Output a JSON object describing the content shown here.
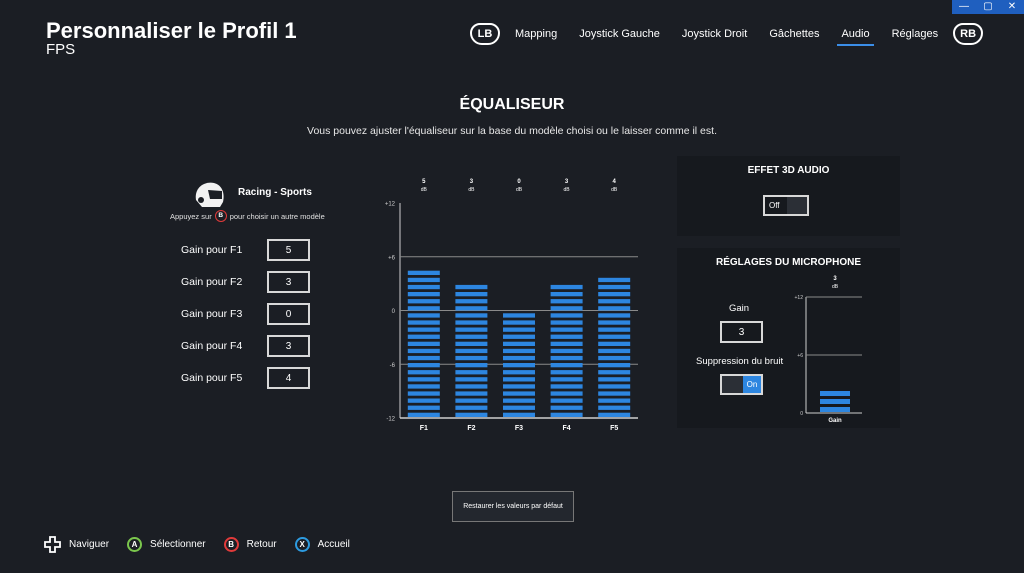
{
  "window": {
    "minimize": "—",
    "maximize": "▢",
    "close": "✕"
  },
  "header": {
    "title": "Personnaliser le Profil 1",
    "subtitle": "FPS",
    "lb": "LB",
    "rb": "RB",
    "tabs": [
      {
        "label": "Mapping",
        "active": false
      },
      {
        "label": "Joystick Gauche",
        "active": false
      },
      {
        "label": "Joystick Droit",
        "active": false
      },
      {
        "label": "Gâchettes",
        "active": false
      },
      {
        "label": "Audio",
        "active": true
      },
      {
        "label": "Réglages",
        "active": false
      }
    ]
  },
  "equalizer": {
    "title": "ÉQUALISEUR",
    "description": "Vous pouvez ajuster l'équaliseur sur la base du modèle choisi ou le laisser comme il est.",
    "preset_name": "Racing - Sports",
    "hint_prefix": "Appuyez sur",
    "hint_button": "B",
    "hint_suffix": "pour choisir un autre modèle",
    "gains": [
      {
        "label": "Gain pour F1",
        "value": "5"
      },
      {
        "label": "Gain pour F2",
        "value": "3"
      },
      {
        "label": "Gain pour F3",
        "value": "0"
      },
      {
        "label": "Gain pour F4",
        "value": "3"
      },
      {
        "label": "Gain pour F5",
        "value": "4"
      }
    ]
  },
  "chart_data": {
    "type": "bar",
    "categories": [
      "F1",
      "F2",
      "F3",
      "F4",
      "F5"
    ],
    "values": [
      5,
      3,
      0,
      3,
      4
    ],
    "value_labels": [
      "5",
      "3",
      "0",
      "3",
      "4"
    ],
    "unit": "dB",
    "ylim": [
      -12,
      12
    ],
    "yticks": [
      "+12",
      "+6",
      "0",
      "-6",
      "-12"
    ],
    "bar_color": "#2d86e0",
    "grid_color": "#8a8a8a"
  },
  "audio3d": {
    "title": "EFFET 3D AUDIO",
    "toggle": "Off"
  },
  "microphone": {
    "title": "RÉGLAGES DU MICROPHONE",
    "gain_label": "Gain",
    "gain_value": "3",
    "noise_label": "Suppression du bruit",
    "noise_toggle": "On",
    "chart": {
      "value": 3,
      "value_label": "3",
      "unit": "dB",
      "ylim": [
        0,
        12
      ],
      "yticks": [
        "+12",
        "+6",
        "0"
      ],
      "xlabel": "Gain"
    }
  },
  "restore_button": "Restaurer les valeurs par défaut",
  "footer": [
    {
      "icon": "dpad-icon",
      "label": "Naviguer"
    },
    {
      "icon": "button-a-icon",
      "glyph": "A",
      "color": "#7bc74d",
      "label": "Sélectionner"
    },
    {
      "icon": "button-b-icon",
      "glyph": "B",
      "color": "#e03a3a",
      "label": "Retour"
    },
    {
      "icon": "button-x-icon",
      "glyph": "X",
      "color": "#2d9be0",
      "label": "Accueil"
    }
  ]
}
